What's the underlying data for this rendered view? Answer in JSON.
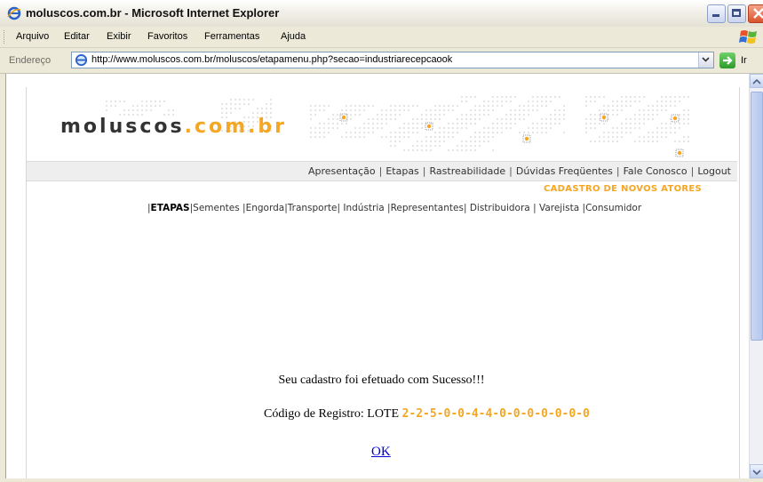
{
  "window": {
    "title": "moluscos.com.br - Microsoft Internet Explorer"
  },
  "menu": {
    "items": [
      "Arquivo",
      "Editar",
      "Exibir",
      "Favoritos",
      "Ferramentas",
      "Ajuda"
    ]
  },
  "address": {
    "label": "Endereço",
    "url": "http://www.moluscos.com.br/moluscos/etapamenu.php?secao=industriarecepcaook",
    "go_label": "Ir"
  },
  "site": {
    "logo_main": "moluscos",
    "logo_accent": ".com.br",
    "accent_color": "#f5a623",
    "nav": [
      "Apresentação",
      "Etapas",
      "Rastreabilidade",
      "Dúvidas Freqüentes",
      "Fale Conosco",
      "Logout"
    ],
    "section_title": "CADASTRO DE NOVOS ATORES",
    "etapas_label": "ETAPAS",
    "etapas": [
      "Sementes",
      "Engorda",
      "Transporte",
      "Indústria",
      "Representantes",
      "Distribuidora",
      "Varejista",
      "Consumidor"
    ]
  },
  "content": {
    "success_message": "Seu cadastro foi efetuado com Sucesso!!!",
    "code_label": "Código de Registro: LOTE",
    "code_value": "2-2-5-0-0-4-4-0-0-0-0-0-0-0",
    "ok_link": "OK"
  }
}
